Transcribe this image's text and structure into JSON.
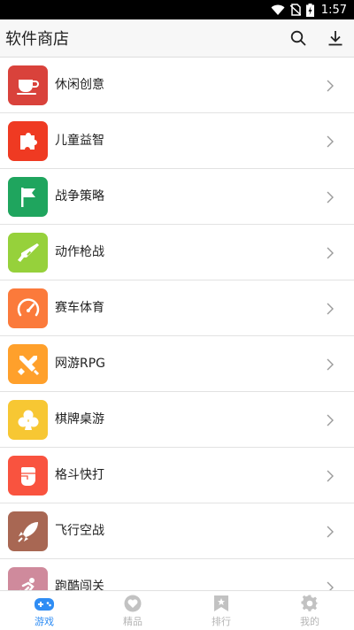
{
  "status_bar": {
    "time": "1:57"
  },
  "app_bar": {
    "title": "软件商店"
  },
  "categories": [
    {
      "label": "休闲创意",
      "color": "#d9423b",
      "icon": "coffee-cup-icon"
    },
    {
      "label": "儿童益智",
      "color": "#ef3a22",
      "icon": "puzzle-icon"
    },
    {
      "label": "战争策略",
      "color": "#1fa55e",
      "icon": "flag-icon"
    },
    {
      "label": "动作枪战",
      "color": "#96d13b",
      "icon": "rifle-icon"
    },
    {
      "label": "赛车体育",
      "color": "#fb7a3b",
      "icon": "speedometer-icon"
    },
    {
      "label": "网游RPG",
      "color": "#ffa02b",
      "icon": "crossed-swords-icon"
    },
    {
      "label": "棋牌桌游",
      "color": "#f7c733",
      "icon": "club-icon"
    },
    {
      "label": "格斗快打",
      "color": "#f9533f",
      "icon": "fist-icon"
    },
    {
      "label": "飞行空战",
      "color": "#a86753",
      "icon": "rocket-icon"
    },
    {
      "label": "跑酷闯关",
      "color": "#cf8a9c",
      "icon": "runner-icon"
    }
  ],
  "tab_bar": {
    "accent": "#2f8df4",
    "inactive": "#b5b5b5",
    "tabs": [
      {
        "label": "游戏",
        "icon": "gamepad-icon",
        "active": true
      },
      {
        "label": "精品",
        "icon": "heart-icon",
        "active": false
      },
      {
        "label": "排行",
        "icon": "ranking-bookmark-icon",
        "active": false
      },
      {
        "label": "我的",
        "icon": "settings-gear-icon",
        "active": false
      }
    ]
  }
}
